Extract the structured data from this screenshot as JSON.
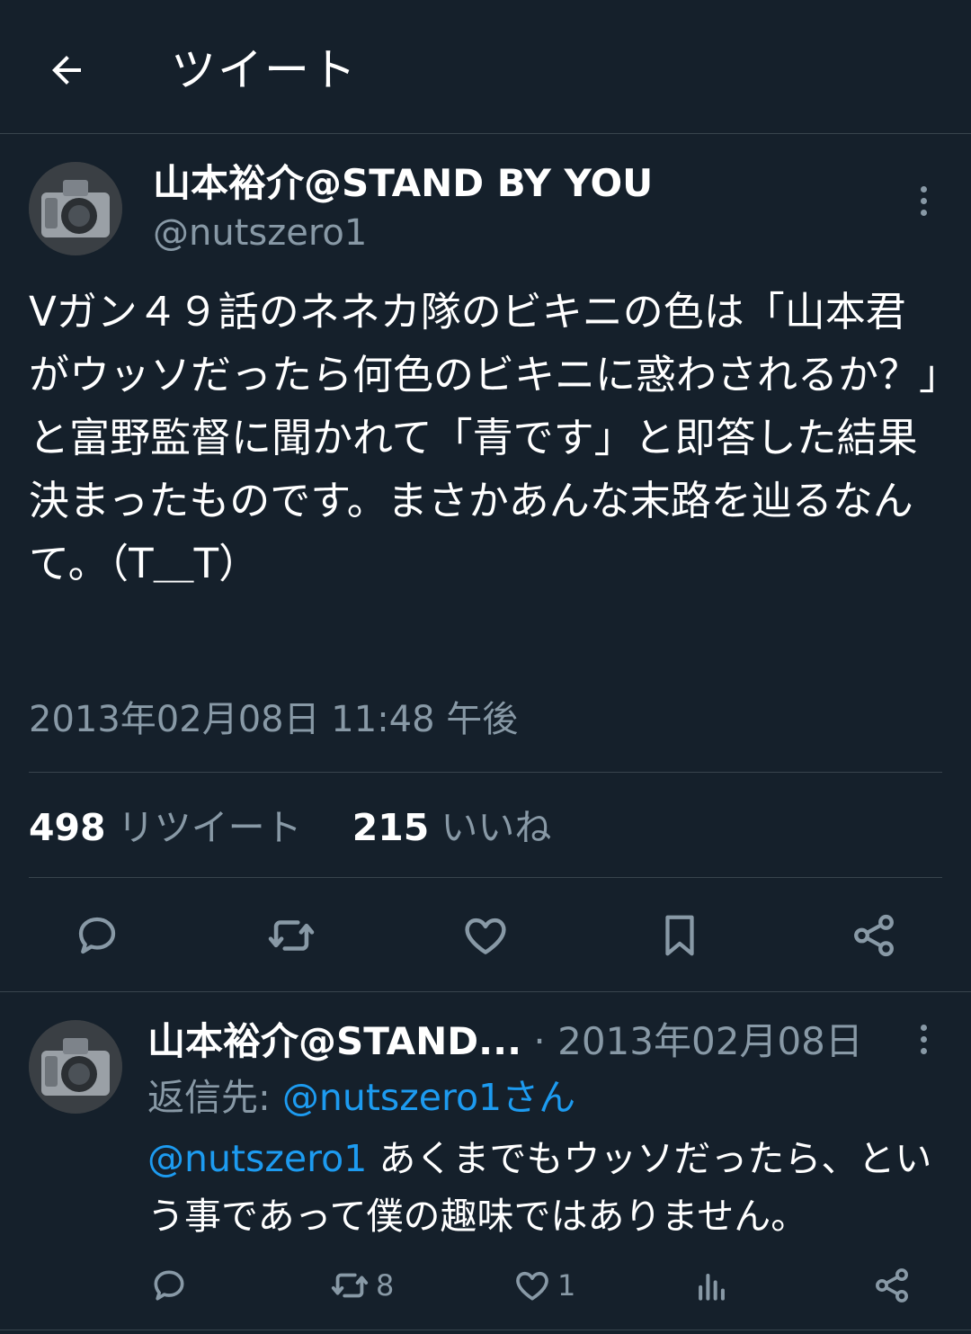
{
  "header": {
    "title": "ツイート",
    "back_icon": "arrow-left-icon"
  },
  "tweet": {
    "display_name": "山本裕介@STAND BY YOU",
    "handle": "@nutszero1",
    "text": "Vガン４９話のネネカ隊のビキニの色は「山本君がウッソだったら何色のビキニに惑わされるか？」と富野監督に聞かれて「青です」と即答した結果決まったものです。まさかあんな末路を辿るなんて。（T＿T）",
    "timestamp": "2013年02月08日 11:48 午後",
    "retweet_count": "498",
    "retweet_label": "リツイート",
    "like_count": "215",
    "like_label": "いいね"
  },
  "actions": [
    {
      "icon": "reply-icon"
    },
    {
      "icon": "retweet-icon"
    },
    {
      "icon": "like-icon"
    },
    {
      "icon": "bookmark-icon"
    },
    {
      "icon": "share-icon"
    }
  ],
  "reply": {
    "display_name": "山本裕介@STAND...",
    "separator": "·",
    "date": "2013年02月08日",
    "reply_to_prefix": "返信先: ",
    "reply_to_target": "@nutszero1さん",
    "mention": "@nutszero1",
    "text": " あくまでもウッソだったら、という事であって僕の趣味ではありません。",
    "retweet_count": "8",
    "like_count": "1"
  },
  "colors": {
    "background": "#15202b",
    "secondary_text": "#8899a6",
    "link": "#1d9bf0",
    "divider": "#38444d"
  }
}
